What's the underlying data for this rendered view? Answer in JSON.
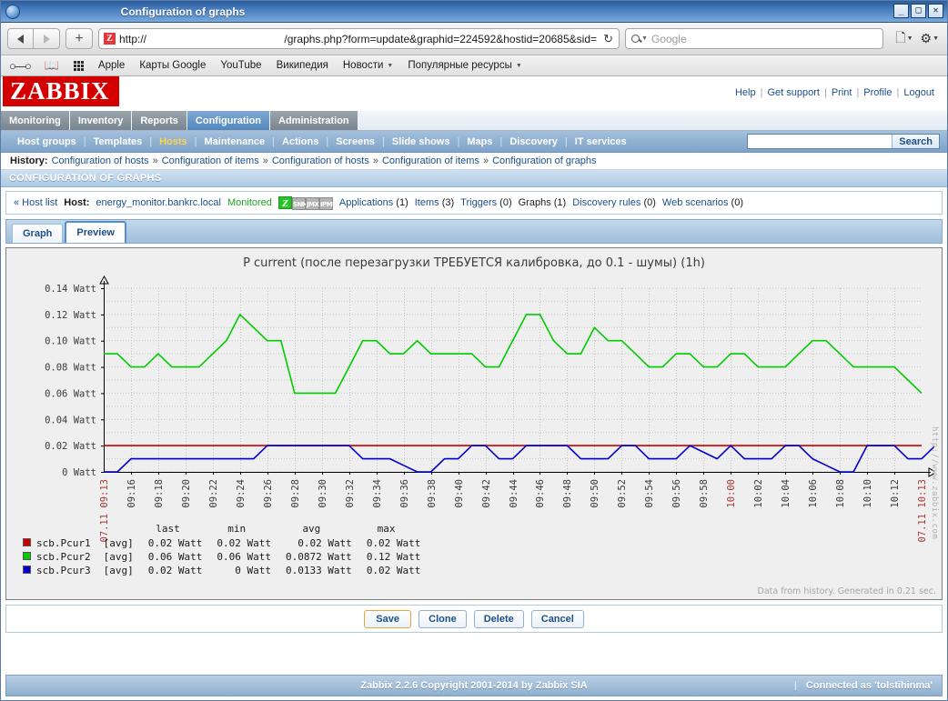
{
  "window": {
    "title": "Configuration of graphs",
    "buttons": {
      "minimize": "_",
      "maximize": "□",
      "close": "✕"
    }
  },
  "browser": {
    "back_icon": "back-arrow",
    "forward_icon": "forward-arrow",
    "new_tab_label": "+",
    "url_scheme": "http://",
    "url_path": "/graphs.php?form=update&graphid=224592&hostid=20685&sid=",
    "reload_icon": "↻",
    "search_placeholder": "Google",
    "search_value": "",
    "toolbar_icons": [
      "page-icon",
      "gear-icon"
    ],
    "bookmarks": [
      {
        "label": "Apple",
        "dropdown": false
      },
      {
        "label": "Карты Google",
        "dropdown": false
      },
      {
        "label": "YouTube",
        "dropdown": false
      },
      {
        "label": "Википедия",
        "dropdown": false
      },
      {
        "label": "Новости",
        "dropdown": true
      },
      {
        "label": "Популярные ресурсы",
        "dropdown": true
      }
    ]
  },
  "zabbix": {
    "logo": "ZABBIX",
    "header_links": [
      "Help",
      "Get support",
      "Print",
      "Profile",
      "Logout"
    ],
    "main_menu": [
      {
        "label": "Monitoring",
        "active": false
      },
      {
        "label": "Inventory",
        "active": false
      },
      {
        "label": "Reports",
        "active": false
      },
      {
        "label": "Configuration",
        "active": true
      },
      {
        "label": "Administration",
        "active": false
      }
    ],
    "sub_menu": [
      {
        "label": "Host groups",
        "selected": false
      },
      {
        "label": "Templates",
        "selected": false
      },
      {
        "label": "Hosts",
        "selected": true
      },
      {
        "label": "Maintenance",
        "selected": false
      },
      {
        "label": "Actions",
        "selected": false
      },
      {
        "label": "Screens",
        "selected": false
      },
      {
        "label": "Slide shows",
        "selected": false
      },
      {
        "label": "Maps",
        "selected": false
      },
      {
        "label": "Discovery",
        "selected": false
      },
      {
        "label": "IT services",
        "selected": false
      }
    ],
    "search": {
      "value": "",
      "button_label": "Search"
    },
    "history": {
      "label": "History:",
      "items": [
        "Configuration of hosts",
        "Configuration of items",
        "Configuration of hosts",
        "Configuration of items",
        "Configuration of graphs"
      ],
      "separator": "»"
    },
    "page_title": "CONFIGURATION OF GRAPHS",
    "hostbar": {
      "back_label": "« Host list",
      "host_label": "Host:",
      "host_name": "energy_monitor.bankrc.local",
      "status": "Monitored",
      "interfaces": [
        {
          "name": "zabbix-agent-icon",
          "text": "Z",
          "active": true
        },
        {
          "name": "snmp-icon",
          "text": "SNMP",
          "active": false
        },
        {
          "name": "jmx-icon",
          "text": "JMX",
          "active": false
        },
        {
          "name": "ipmi-icon",
          "text": "IPMI",
          "active": false
        }
      ],
      "entities": [
        {
          "label": "Applications",
          "count": "(1)",
          "link": true
        },
        {
          "label": "Items",
          "count": "(3)",
          "link": true
        },
        {
          "label": "Triggers",
          "count": "(0)",
          "link": true
        },
        {
          "label": "Graphs",
          "count": "(1)",
          "link": false
        },
        {
          "label": "Discovery rules",
          "count": "(0)",
          "link": true
        },
        {
          "label": "Web scenarios",
          "count": "(0)",
          "link": true
        }
      ]
    },
    "tabs": [
      {
        "label": "Graph",
        "selected": false
      },
      {
        "label": "Preview",
        "selected": true
      }
    ],
    "form_buttons": [
      {
        "label": "Save",
        "primary": true
      },
      {
        "label": "Clone",
        "primary": false
      },
      {
        "label": "Delete",
        "primary": false
      },
      {
        "label": "Cancel",
        "primary": false
      }
    ],
    "generated_note": "Data from history. Generated in 0.21 sec.",
    "watermark": "http://www.zabbix.com",
    "footer": {
      "copyright": "Zabbix 2.2.6 Copyright 2001-2014 by Zabbix SIA",
      "connected_as": "Connected as 'tolstihinma'"
    }
  },
  "chart_data": {
    "type": "line",
    "title": "P current (после перезагрузки ТРЕБУЕТСЯ калибровка, до 0.1 - шумы) (1h)",
    "xlabel": "",
    "ylabel": "Watt",
    "ylim": [
      0,
      0.14
    ],
    "grid": true,
    "legend_position": "bottom",
    "y_ticks": [
      "0.14 Watt",
      "0.12 Watt",
      "0.10 Watt",
      "0.08 Watt",
      "0.06 Watt",
      "0.04 Watt",
      "0.02 Watt",
      "0 Watt"
    ],
    "y_tick_values": [
      0.14,
      0.12,
      0.1,
      0.08,
      0.06,
      0.04,
      0.02,
      0
    ],
    "x_start_label": "07.11 09:13",
    "x_end_label": "07.11 10:13",
    "x_ticks": [
      "09:16",
      "09:18",
      "09:20",
      "09:22",
      "09:24",
      "09:26",
      "09:28",
      "09:30",
      "09:32",
      "09:34",
      "09:36",
      "09:38",
      "09:40",
      "09:42",
      "09:44",
      "09:46",
      "09:48",
      "09:50",
      "09:52",
      "09:54",
      "09:56",
      "09:58",
      "10:00",
      "10:02",
      "10:04",
      "10:06",
      "10:08",
      "10:10",
      "10:12"
    ],
    "x_tick_highlight": [
      "10:00"
    ],
    "series": [
      {
        "name": "scb.Pcur1",
        "aggregation": "[avg]",
        "color": "#cc0000",
        "last": "0.02 Watt",
        "min": "0.02 Watt",
        "avg": "0.02 Watt",
        "max": "0.02 Watt",
        "values": [
          0.02,
          0.02,
          0.02,
          0.02,
          0.02,
          0.02,
          0.02,
          0.02,
          0.02,
          0.02,
          0.02,
          0.02,
          0.02,
          0.02,
          0.02,
          0.02,
          0.02,
          0.02,
          0.02,
          0.02,
          0.02,
          0.02,
          0.02,
          0.02,
          0.02,
          0.02,
          0.02,
          0.02,
          0.02,
          0.02,
          0.02,
          0.02,
          0.02,
          0.02,
          0.02,
          0.02,
          0.02,
          0.02,
          0.02,
          0.02,
          0.02,
          0.02,
          0.02,
          0.02,
          0.02,
          0.02,
          0.02,
          0.02,
          0.02,
          0.02,
          0.02,
          0.02,
          0.02,
          0.02,
          0.02,
          0.02,
          0.02,
          0.02,
          0.02,
          0.02,
          0.02
        ]
      },
      {
        "name": "scb.Pcur2",
        "aggregation": "[avg]",
        "color": "#00cc00",
        "last": "0.06 Watt",
        "min": "0.06 Watt",
        "avg": "0.0872 Watt",
        "max": "0.12 Watt",
        "values": [
          0.09,
          0.09,
          0.08,
          0.08,
          0.09,
          0.08,
          0.08,
          0.08,
          0.09,
          0.1,
          0.12,
          0.11,
          0.1,
          0.1,
          0.06,
          0.06,
          0.06,
          0.06,
          0.08,
          0.1,
          0.1,
          0.09,
          0.09,
          0.1,
          0.09,
          0.09,
          0.09,
          0.09,
          0.08,
          0.08,
          0.1,
          0.12,
          0.12,
          0.1,
          0.09,
          0.09,
          0.11,
          0.1,
          0.1,
          0.09,
          0.08,
          0.08,
          0.09,
          0.09,
          0.08,
          0.08,
          0.09,
          0.09,
          0.08,
          0.08,
          0.08,
          0.09,
          0.1,
          0.1,
          0.09,
          0.08,
          0.08,
          0.08,
          0.08,
          0.07,
          0.06
        ]
      },
      {
        "name": "scb.Pcur3",
        "aggregation": "[avg]",
        "color": "#0000cc",
        "last": "0.02 Watt",
        "min": "0 Watt",
        "avg": "0.0133 Watt",
        "max": "0.02 Watt",
        "values": [
          0,
          0,
          0.01,
          0.01,
          0.01,
          0.01,
          0.01,
          0.01,
          0.01,
          0.01,
          0.01,
          0.01,
          0.02,
          0.02,
          0.02,
          0.02,
          0.02,
          0.02,
          0.02,
          0.01,
          0.01,
          0.01,
          0.005,
          0,
          0,
          0.01,
          0.01,
          0.02,
          0.02,
          0.01,
          0.01,
          0.02,
          0.02,
          0.02,
          0.02,
          0.01,
          0.01,
          0.01,
          0.02,
          0.02,
          0.01,
          0.01,
          0.01,
          0.02,
          0.015,
          0.01,
          0.02,
          0.01,
          0.01,
          0.01,
          0.02,
          0.02,
          0.01,
          0.005,
          0,
          0,
          0.02,
          0.02,
          0.02,
          0.01,
          0.01,
          0.02
        ]
      }
    ]
  }
}
